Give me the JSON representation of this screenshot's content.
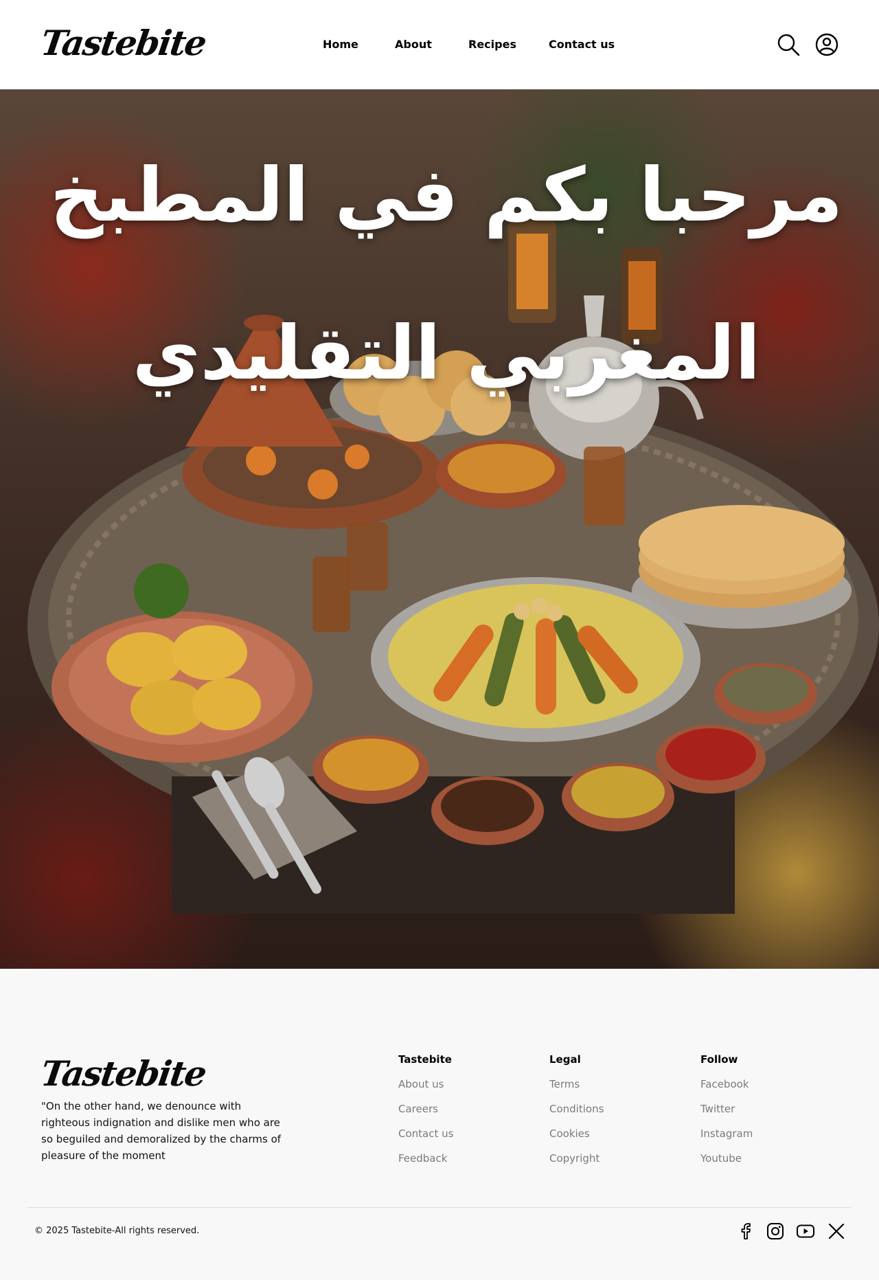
{
  "brand": {
    "name": "Tastebite"
  },
  "nav": {
    "items": [
      {
        "label": "Home"
      },
      {
        "label": "About"
      },
      {
        "label": "Recipes"
      },
      {
        "label": "Contact us"
      }
    ],
    "icons": [
      "search-icon",
      "user-icon"
    ]
  },
  "hero": {
    "title": "مرحبا بكم في المطبخ المغربي التقليدي"
  },
  "footer": {
    "description": "\"On the other hand, we denounce with righteous indignation and dislike men who are so beguiled and demoralized by the charms of pleasure of the moment",
    "columns": [
      {
        "title": "Tastebite",
        "links": [
          "About us",
          "Careers",
          "Contact us",
          "Feedback"
        ]
      },
      {
        "title": "Legal",
        "links": [
          "Terms",
          "Conditions",
          "Cookies",
          "Copyright"
        ]
      },
      {
        "title": "Follow",
        "links": [
          "Facebook",
          "Twitter",
          "Instagram",
          "Youtube"
        ]
      }
    ],
    "copyright": "© 2025 Tastebite-All rights reserved.",
    "social_icons": [
      "facebook-icon",
      "instagram-icon",
      "youtube-icon",
      "x-icon"
    ]
  },
  "colors": {
    "header_bg": "#ffffff",
    "footer_bg": "#f8f8f8",
    "link_muted": "#7a7a7a",
    "text": "#000000"
  }
}
